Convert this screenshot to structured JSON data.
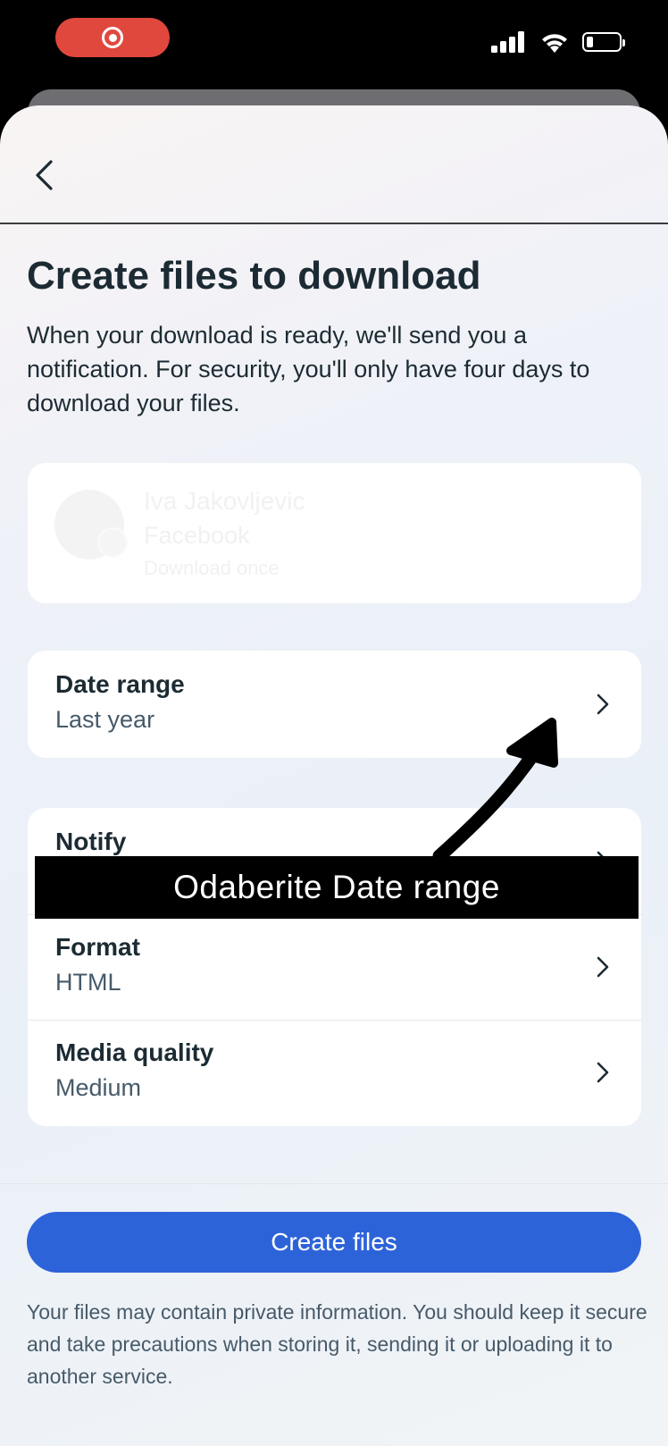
{
  "status_bar": {
    "record_icon": "screen-record-icon",
    "signal_icon": "cellular-signal-icon",
    "wifi_icon": "wifi-icon",
    "battery_icon": "battery-icon",
    "battery_level": 0.2,
    "record_color": "#e0483e"
  },
  "nav": {
    "back_icon": "chevron-left-icon"
  },
  "page": {
    "title": "Create files to download",
    "description": "When your download is ready, we'll send you a notification. For security, you'll only have four days to download your files."
  },
  "profile": {
    "name": "Iva Jakovljevic",
    "platform": "Facebook",
    "frequency": "Download once",
    "avatar_icon": "avatar-icon",
    "badge_icon": "facebook-icon"
  },
  "options": {
    "date_range": {
      "label": "Date range",
      "value": "Last year"
    },
    "notify": {
      "label": "Notify",
      "value": ""
    },
    "format": {
      "label": "Format",
      "value": "HTML"
    },
    "media_quality": {
      "label": "Media quality",
      "value": "Medium"
    },
    "chevron_icon": "chevron-right-icon"
  },
  "annotation": {
    "caption": "Odaberite Date range",
    "arrow_icon": "hand-drawn-arrow-icon"
  },
  "footer": {
    "create_button": "Create files",
    "disclaimer": "Your files may contain private information. You should keep it secure and take precautions when storing it, sending it or uploading it to another service.",
    "accent_color": "#2d63d9"
  }
}
